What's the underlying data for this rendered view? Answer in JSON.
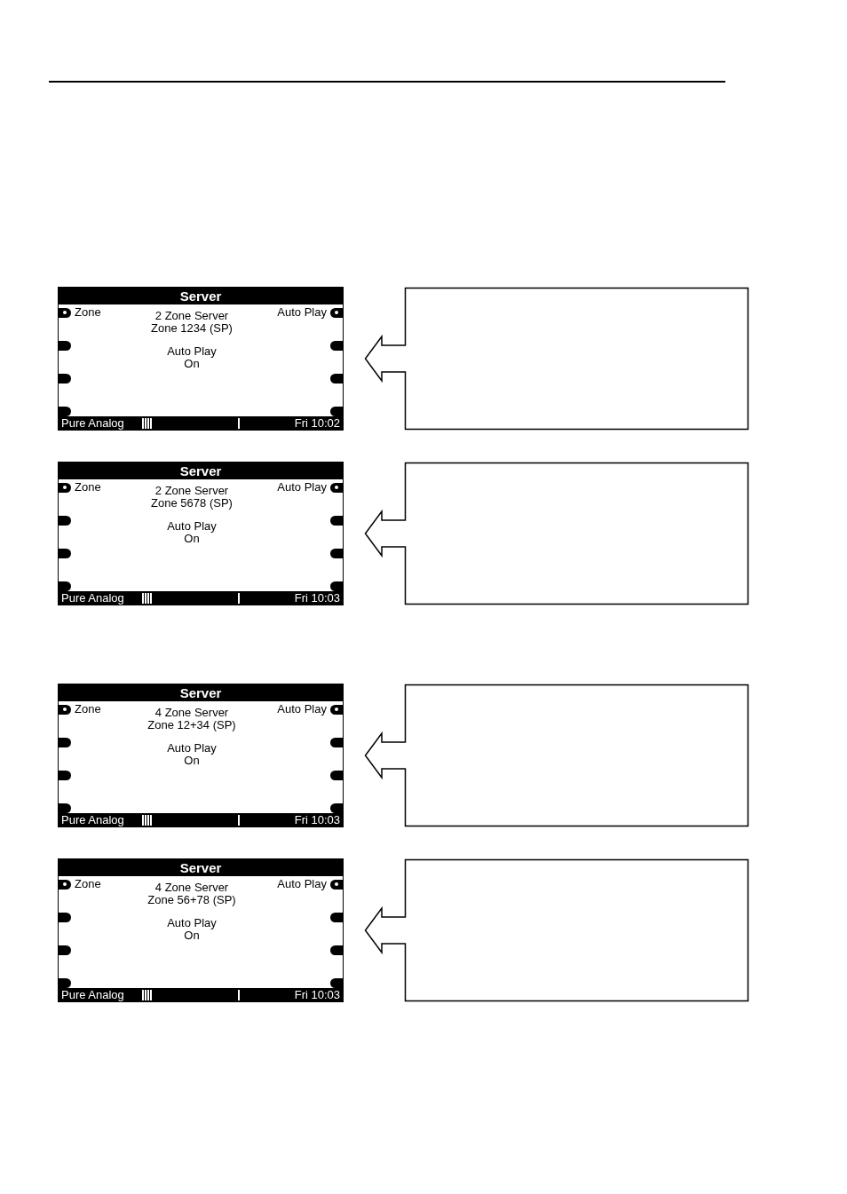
{
  "screens": [
    {
      "title": "Server",
      "left_label": "Zone",
      "right_label": "Auto Play",
      "info": [
        "2 Zone Server",
        "Zone 1234 (SP)"
      ],
      "setting": [
        "Auto Play",
        "On"
      ],
      "status": {
        "source": "Pure Analog",
        "time": "Fri 10:02"
      }
    },
    {
      "title": "Server",
      "left_label": "Zone",
      "right_label": "Auto Play",
      "info": [
        "2 Zone Server",
        "Zone 5678 (SP)"
      ],
      "setting": [
        "Auto Play",
        "On"
      ],
      "status": {
        "source": "Pure Analog",
        "time": "Fri 10:03"
      }
    },
    {
      "title": "Server",
      "left_label": "Zone",
      "right_label": "Auto Play",
      "info": [
        "4 Zone Server",
        "Zone 12+34 (SP)"
      ],
      "setting": [
        "Auto Play",
        "On"
      ],
      "status": {
        "source": "Pure Analog",
        "time": "Fri 10:03"
      }
    },
    {
      "title": "Server",
      "left_label": "Zone",
      "right_label": "Auto Play",
      "info": [
        "4 Zone Server",
        "Zone 56+78 (SP)"
      ],
      "setting": [
        "Auto Play",
        "On"
      ],
      "status": {
        "source": "Pure Analog",
        "time": "Fri 10:03"
      }
    }
  ]
}
